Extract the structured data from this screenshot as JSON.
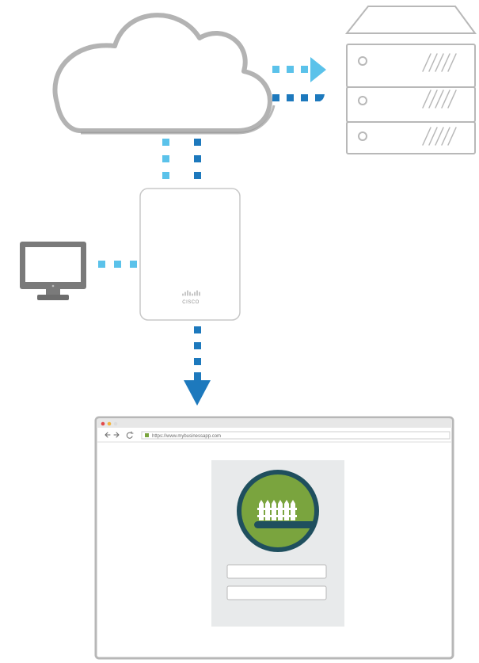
{
  "diagram": {
    "colors": {
      "light_blue": "#5bc2ea",
      "dark_blue": "#1d79bd",
      "outline_gray": "#b8b8b8",
      "monitor_gray": "#7a7a7a",
      "panel_gray": "#e8eaeb",
      "logo_green": "#7aa43e",
      "logo_teal": "#1f4f5e"
    },
    "cloud": {
      "icon": "cloud-icon"
    },
    "server": {
      "icon": "server-rack-icon",
      "units": 3
    },
    "access_point": {
      "icon": "wireless-access-point-icon",
      "brand": "CISCO"
    },
    "client": {
      "icon": "desktop-monitor-icon"
    },
    "browser": {
      "icon": "browser-window-icon",
      "url": "https://www.mybusinessapp.com",
      "login": {
        "logo_icon": "fence-logo-icon",
        "fields": 2
      }
    }
  }
}
